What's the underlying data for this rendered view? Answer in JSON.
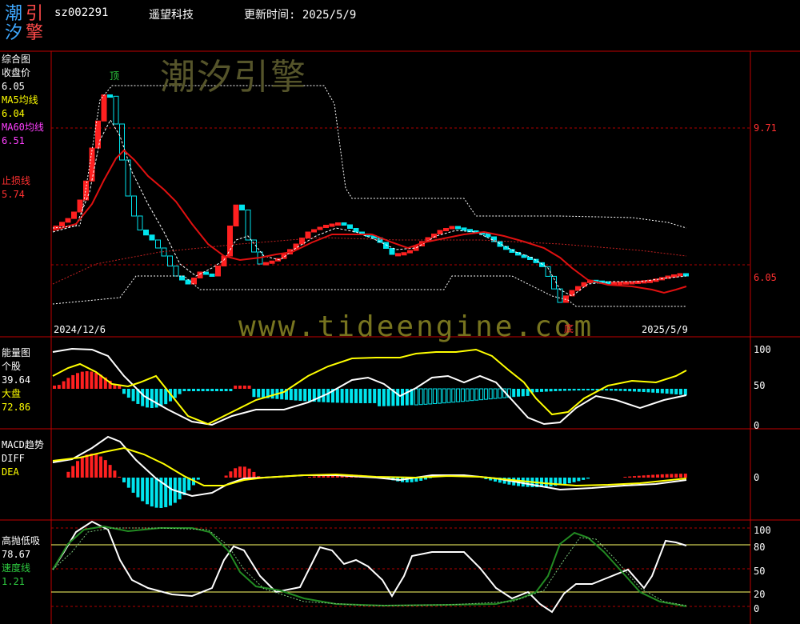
{
  "header": {
    "logo_chars": [
      "潮",
      "引",
      "汐",
      "擎"
    ],
    "code": "sz002291",
    "name": "遥望科技",
    "update_label": "更新时间: 2025/5/9"
  },
  "watermark": {
    "cn": "潮汐引擎",
    "url": "www.tideengine.com"
  },
  "panel_main": {
    "title": "综合图",
    "close_label": "收盘价",
    "close_value": "6.05",
    "ma5_label": "MA5均线",
    "ma5_value": "6.04",
    "ma60_label": "MA60均线",
    "ma60_value": "6.51",
    "stop_label": "止损线",
    "stop_value": "5.74",
    "top_marker": "顶",
    "bottom_marker": "底",
    "date_start": "2024/12/6",
    "date_end": "2025/5/9",
    "right_level_1": "9.71",
    "right_level_2": "6.05"
  },
  "panel_energy": {
    "title": "能量图",
    "stock_label": "个股",
    "stock_value": "39.64",
    "market_label": "大盘",
    "market_value": "72.86",
    "ticks": [
      "100",
      "50",
      "0"
    ]
  },
  "panel_macd": {
    "title": "MACD趋势",
    "diff_label": "DIFF",
    "dea_label": "DEA",
    "ticks": [
      "0"
    ]
  },
  "panel_kdj": {
    "title": "高抛低吸",
    "value": "78.67",
    "speed_label": "速度线",
    "speed_value": "1.21",
    "ticks": [
      "100",
      "80",
      "50",
      "20",
      "0"
    ]
  },
  "colors": {
    "up": "#ff2020",
    "down": "#00e5ee",
    "ma60": "#e01010",
    "frame": "#c00000"
  }
}
